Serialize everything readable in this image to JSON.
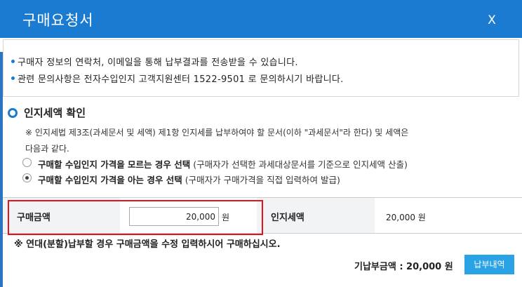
{
  "dialog": {
    "title": "구매요청서",
    "close_label": "X"
  },
  "notice": {
    "lines": [
      "구매자 정보의 연락처, 이메일을 통해 납부결과를 전송받을 수 있습니다.",
      "관련 문의사항은 전자수입인지 고객지원센터 1522-9501 로 문의하시기 바랍니다."
    ]
  },
  "section": {
    "title": "인지세액 확인",
    "desc_lines": [
      "※ 인지세법 제3조(과세문서 및 세액) 제1항 인지세를 납부하여야 할 문서(이하 \"과세문서\"라 한다) 및 세액은",
      "다음과 같다."
    ],
    "options": [
      {
        "label": "구매할 수입인지 가격을 모르는 경우 선택",
        "sub": " (구매자가 선택한 과세대상문서를 기준으로 인지세액 산출)",
        "checked": false
      },
      {
        "label": "구매할 수입인지 가격을 아는 경우 선택",
        "sub": " (구매자가 구매가격을 직접 입력하여 발급)",
        "checked": true
      }
    ]
  },
  "table": {
    "amount_label": "구매금액",
    "amount_value": "20,000",
    "amount_unit": "원",
    "stamp_label": "인지세액",
    "stamp_value": "20,000 원"
  },
  "footnote": "※ 연대(분할)납부할 경우 구매금액을 수정 입력하시어 구매하십시오.",
  "payment": {
    "paid_label": "기납부금액 : 20,000 원",
    "history_button": "납부내역"
  },
  "colors": {
    "titlebar": "#1b7bd1",
    "highlight": "#e0141a",
    "button": "#29a3e6"
  }
}
